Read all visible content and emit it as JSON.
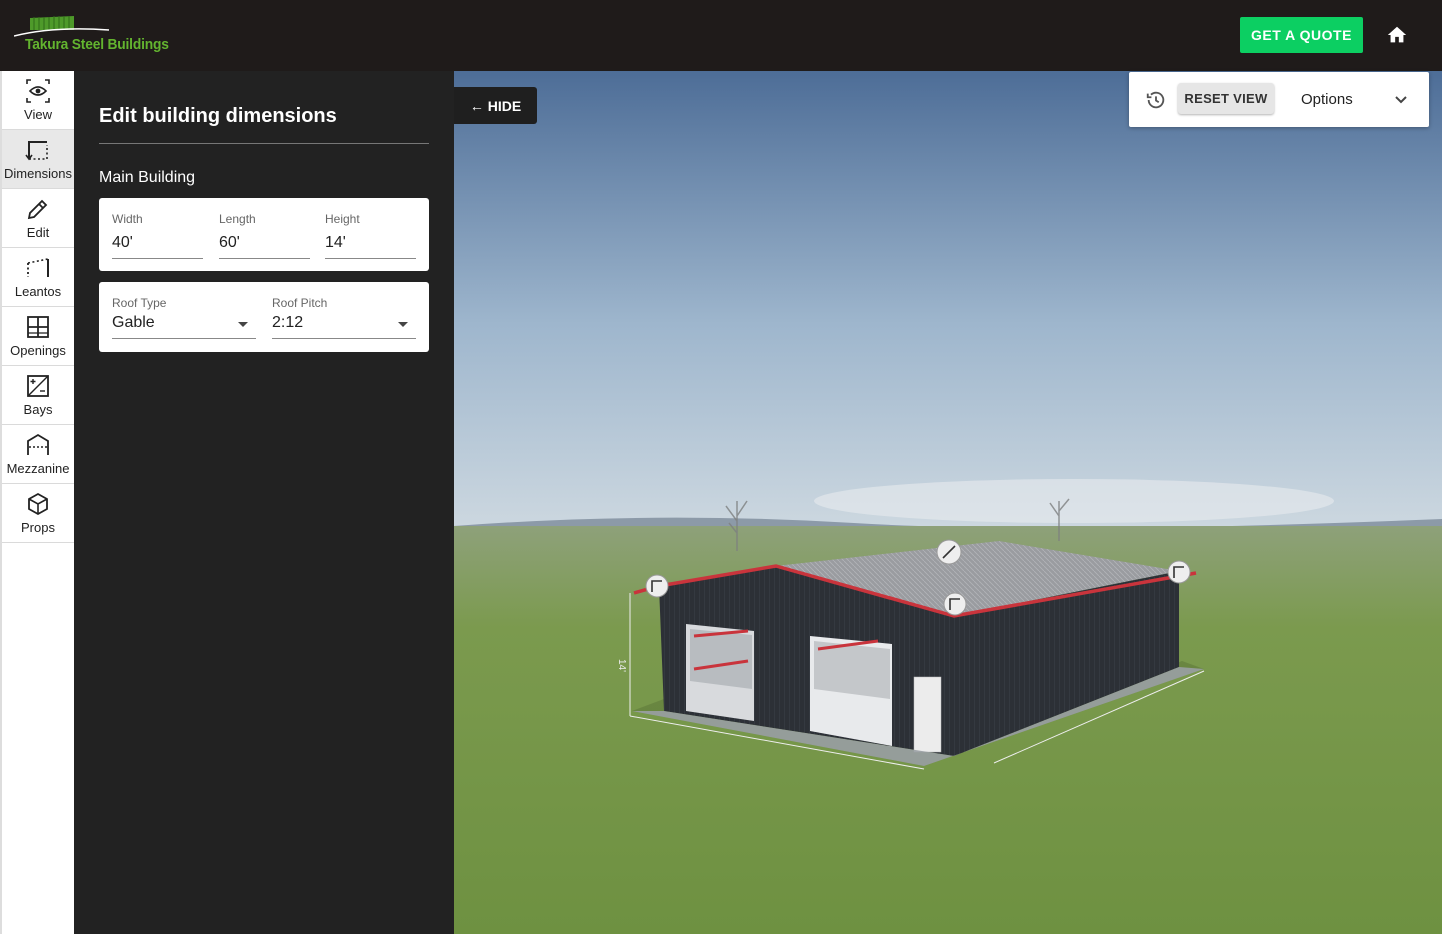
{
  "header": {
    "logo_text": "Takura Steel Buildings",
    "quote_label": "GET A QUOTE"
  },
  "toolbar": {
    "items": [
      {
        "label": "View",
        "icon": "eye-icon"
      },
      {
        "label": "Dimensions",
        "icon": "dimensions-icon"
      },
      {
        "label": "Edit",
        "icon": "pencil-icon"
      },
      {
        "label": "Leantos",
        "icon": "leanto-icon"
      },
      {
        "label": "Openings",
        "icon": "openings-icon"
      },
      {
        "label": "Bays",
        "icon": "bays-icon"
      },
      {
        "label": "Mezzanine",
        "icon": "mezzanine-icon"
      },
      {
        "label": "Props",
        "icon": "cube-icon"
      }
    ],
    "active": "Dimensions"
  },
  "panel": {
    "title": "Edit building dimensions",
    "section": "Main Building",
    "width": {
      "label": "Width",
      "value": "40'"
    },
    "length": {
      "label": "Length",
      "value": "60'"
    },
    "height": {
      "label": "Height",
      "value": "14'"
    },
    "roof_type": {
      "label": "Roof Type",
      "value": "Gable"
    },
    "roof_pitch": {
      "label": "Roof Pitch",
      "value": "2:12"
    }
  },
  "viewport": {
    "hide_label": "← HIDE",
    "reset_label": "RESET VIEW",
    "options_label": "Options",
    "height_marker": "14'"
  },
  "colors": {
    "brand_green": "#63b42f",
    "quote_green": "#0ccf62",
    "building_wall": "#2c3036",
    "trim_red": "#c9343c"
  }
}
